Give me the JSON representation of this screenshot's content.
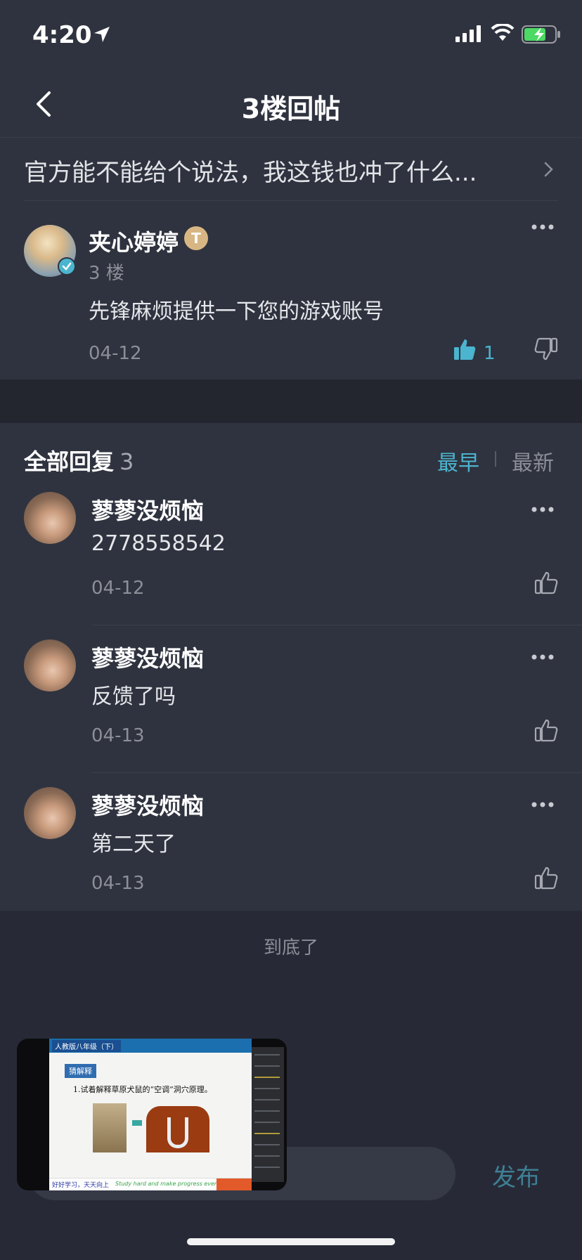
{
  "status_bar": {
    "time": "4:20"
  },
  "nav": {
    "title": "3楼回帖"
  },
  "topic": {
    "text": "官方能不能给个说法，我这钱也冲了什么..."
  },
  "op": {
    "name": "夹心婷婷",
    "level_badge": "T",
    "floor": "3 楼",
    "content": "先锋麻烦提供一下您的游戏账号",
    "date": "04-12",
    "like_count": "1"
  },
  "replies_section": {
    "title": "全部回复",
    "count": "3",
    "sort_earliest": "最早",
    "sort_latest": "最新"
  },
  "replies": [
    {
      "name": "蓼蓼没烦恼",
      "text": "2778558542",
      "date": "04-12"
    },
    {
      "name": "蓼蓼没烦恼",
      "text": "反馈了吗",
      "date": "04-13"
    },
    {
      "name": "蓼蓼没烦恼",
      "text": "第二天了",
      "date": "04-13"
    }
  ],
  "end_text": "到底了",
  "input": {
    "publish_label": "发布"
  },
  "pip": {
    "top_label": "人教版八年级（下）",
    "tag": "猜解释",
    "title": "1.试着解释草原犬鼠的“空调”洞穴原理。",
    "footer_cn": "好好学习，天天向上",
    "footer_en": "Study hard and make progress every day"
  },
  "colors": {
    "accent": "#4bb4cf",
    "background": "#272a36",
    "card": "#2f333f"
  }
}
